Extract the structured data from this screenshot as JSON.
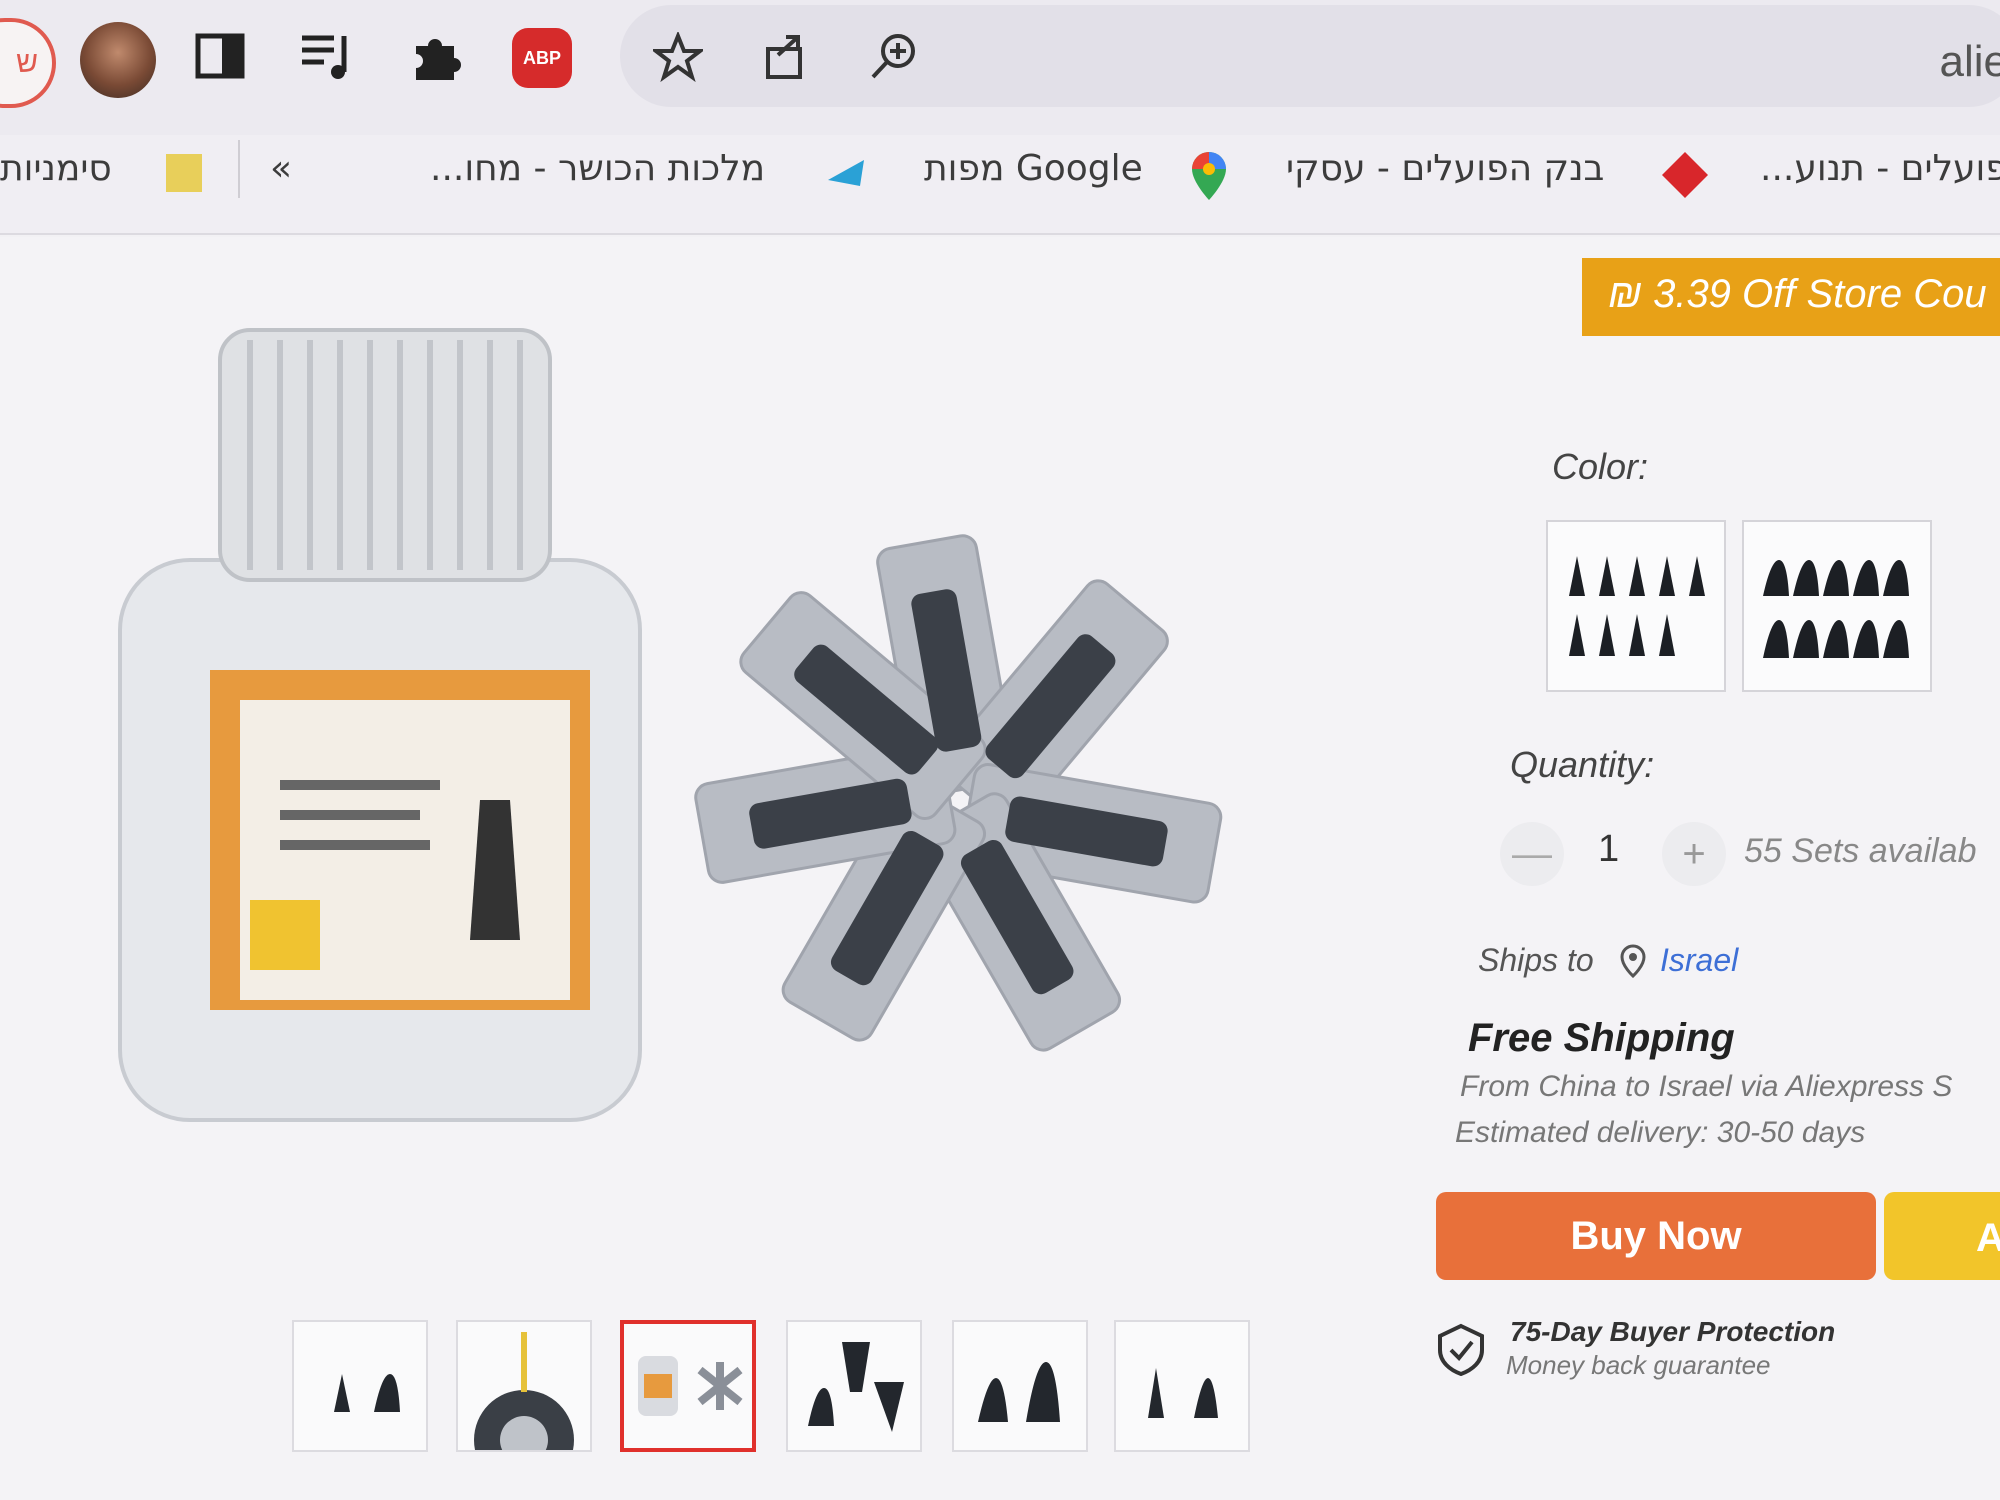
{
  "browser": {
    "url_fragment": "aliex",
    "profile_letter": "ש",
    "abp_label": "ABP",
    "icons": [
      "avatar-icon",
      "sidebar-icon",
      "reading-list-icon",
      "extensions-puzzle-icon",
      "adblock-icon",
      "star-bookmark-icon",
      "share-icon",
      "zoom-icon"
    ]
  },
  "bookmarks": {
    "all_bookmarks": "סימניות",
    "overflow": "»",
    "items": [
      "מלכות הכושר - מחו...",
      "Google מפות",
      "בנק הפועלים - עסקי",
      "פועלים - תנוע..."
    ]
  },
  "product": {
    "coupon": "₪ 3.39 Off Store Cou",
    "color_label": "Color:",
    "quantity_label": "Quantity:",
    "quantity_value": "1",
    "qty_minus": "—",
    "qty_plus": "+",
    "availability": "55 Sets availab",
    "ships_to_label": "Ships to",
    "ships_to_location": "Israel",
    "shipping_title": "Free Shipping",
    "shipping_route": "From China to Israel via Aliexpress S",
    "estimated_delivery": "Estimated delivery: 30-50 days",
    "buy_now": "Buy Now",
    "add_to_cart": "A",
    "protection_title": "75-Day Buyer Protection",
    "protection_subtitle": "Money back guarantee",
    "thumbnail_count": 6,
    "active_thumbnail": 3
  },
  "colors": {
    "accent_orange": "#e8703a",
    "coupon_orange": "#e8a117",
    "cart_yellow": "#f2c52a",
    "link_blue": "#3d6fd6",
    "active_thumb_red": "#e0302c"
  }
}
